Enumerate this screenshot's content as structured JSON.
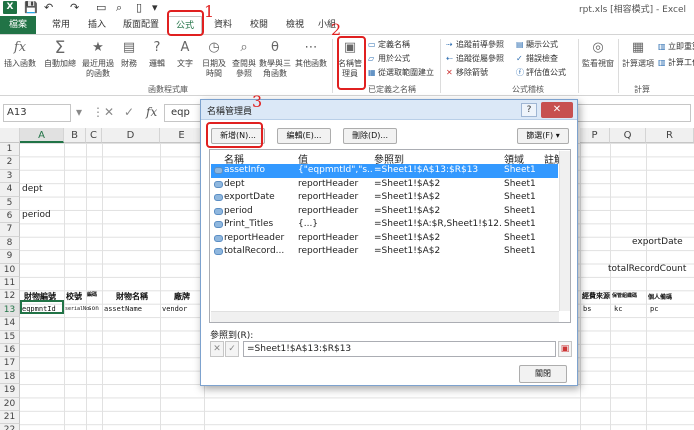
{
  "window": {
    "title": "rpt.xls [相容模式] - Excel"
  },
  "qat": {
    "save_icon": "save-icon",
    "undo_icon": "undo-icon",
    "redo_icon": "redo-icon"
  },
  "tabs": [
    {
      "label": "檔案"
    },
    {
      "label": "常用"
    },
    {
      "label": "插入"
    },
    {
      "label": "版面配置"
    },
    {
      "label": "公式"
    },
    {
      "label": "資料"
    },
    {
      "label": "校閱"
    },
    {
      "label": "檢視"
    },
    {
      "label": "小組"
    }
  ],
  "ribbon": {
    "insert_function": "插入函數",
    "autosum": "自動加總",
    "recent": "最近用過的函數",
    "financial": "財務",
    "logical": "邏輯",
    "text": "文字",
    "datetime": "日期及時間",
    "lookup": "查閱與參照",
    "math": "數學與三角函數",
    "more": "其他函數",
    "function_library_label": "函數程式庫",
    "name_manager": "名稱管理員",
    "define_name": "定義名稱",
    "use_in_formula": "用於公式",
    "create_from_selection": "從選取範圍建立",
    "defined_names_label": "已定義之名稱",
    "trace_precedents": "追蹤前導參照",
    "trace_dependents": "追蹤從屬參照",
    "remove_arrows": "移除箭號",
    "show_formulas": "顯示公式",
    "error_checking": "錯誤檢查",
    "evaluate_formula": "評估值公式",
    "formula_auditing_label": "公式稽核",
    "watch_window": "監看視窗",
    "calc_options": "計算選項",
    "calc_now": "立即重算",
    "calc_sheet": "計算工作表",
    "calculation_label": "計算"
  },
  "annotations": [
    "1",
    "2",
    "3"
  ],
  "formula_bar": {
    "name_box": "A13",
    "formula": "eqp"
  },
  "sheet": {
    "columns": [
      "A",
      "B",
      "C",
      "D",
      "E",
      "P",
      "Q",
      "R"
    ],
    "rows": [
      "1",
      "2",
      "3",
      "4",
      "5",
      "6",
      "7",
      "8",
      "9",
      "10",
      "11",
      "12",
      "13",
      "14",
      "15",
      "16",
      "17",
      "18",
      "19",
      "20",
      "21",
      "22"
    ],
    "cells": {
      "A4": "dept",
      "A6": "period",
      "Q8": "exportDate",
      "Q10": "totalRecordCount",
      "A12": "財物編號",
      "B12": "校號",
      "C12": "編碼",
      "D12": "財物名稱",
      "E12": "廠牌",
      "P12": "經費來源",
      "Q12": "保管組織碼",
      "R12": "個人備碼",
      "A13": "eqpmntId",
      "B13": "serialNo",
      "C13": "son",
      "D13": "assetName",
      "E13": "vendor",
      "P13": "bs",
      "Q13": "kc",
      "R13": "pc"
    }
  },
  "dialog": {
    "title": "名稱管理員",
    "help": "?",
    "close": "✕",
    "btn_new": "新增(N)...",
    "btn_edit": "編輯(E)...",
    "btn_delete": "刪除(D)...",
    "btn_filter": "篩選(F)",
    "headers": {
      "name": "名稱",
      "value": "值",
      "refers": "參照到",
      "scope": "領域",
      "comment": "註解"
    },
    "rows": [
      {
        "name": "assetInfo",
        "value": "{\"eqpmntId\",\"s...",
        "refers": "=Sheet1!$A$13:$R$13",
        "scope": "Sheet1",
        "selected": true
      },
      {
        "name": "dept",
        "value": "reportHeader",
        "refers": "=Sheet1!$A$2",
        "scope": "Sheet1",
        "selected": false
      },
      {
        "name": "exportDate",
        "value": "reportHeader",
        "refers": "=Sheet1!$A$2",
        "scope": "Sheet1",
        "selected": false
      },
      {
        "name": "period",
        "value": "reportHeader",
        "refers": "=Sheet1!$A$2",
        "scope": "Sheet1",
        "selected": false
      },
      {
        "name": "Print_Titles",
        "value": "{...}",
        "refers": "=Sheet1!$A:$R,Sheet1!$12...",
        "scope": "Sheet1",
        "selected": false
      },
      {
        "name": "reportHeader",
        "value": "reportHeader",
        "refers": "=Sheet1!$A$2",
        "scope": "Sheet1",
        "selected": false
      },
      {
        "name": "totalRecord...",
        "value": "reportHeader",
        "refers": "=Sheet1!$A$2",
        "scope": "Sheet1",
        "selected": false
      }
    ],
    "refers_label": "參照到(R):",
    "refers_value": "=Sheet1!$A$13:$R$13",
    "btn_close": "關閉"
  }
}
